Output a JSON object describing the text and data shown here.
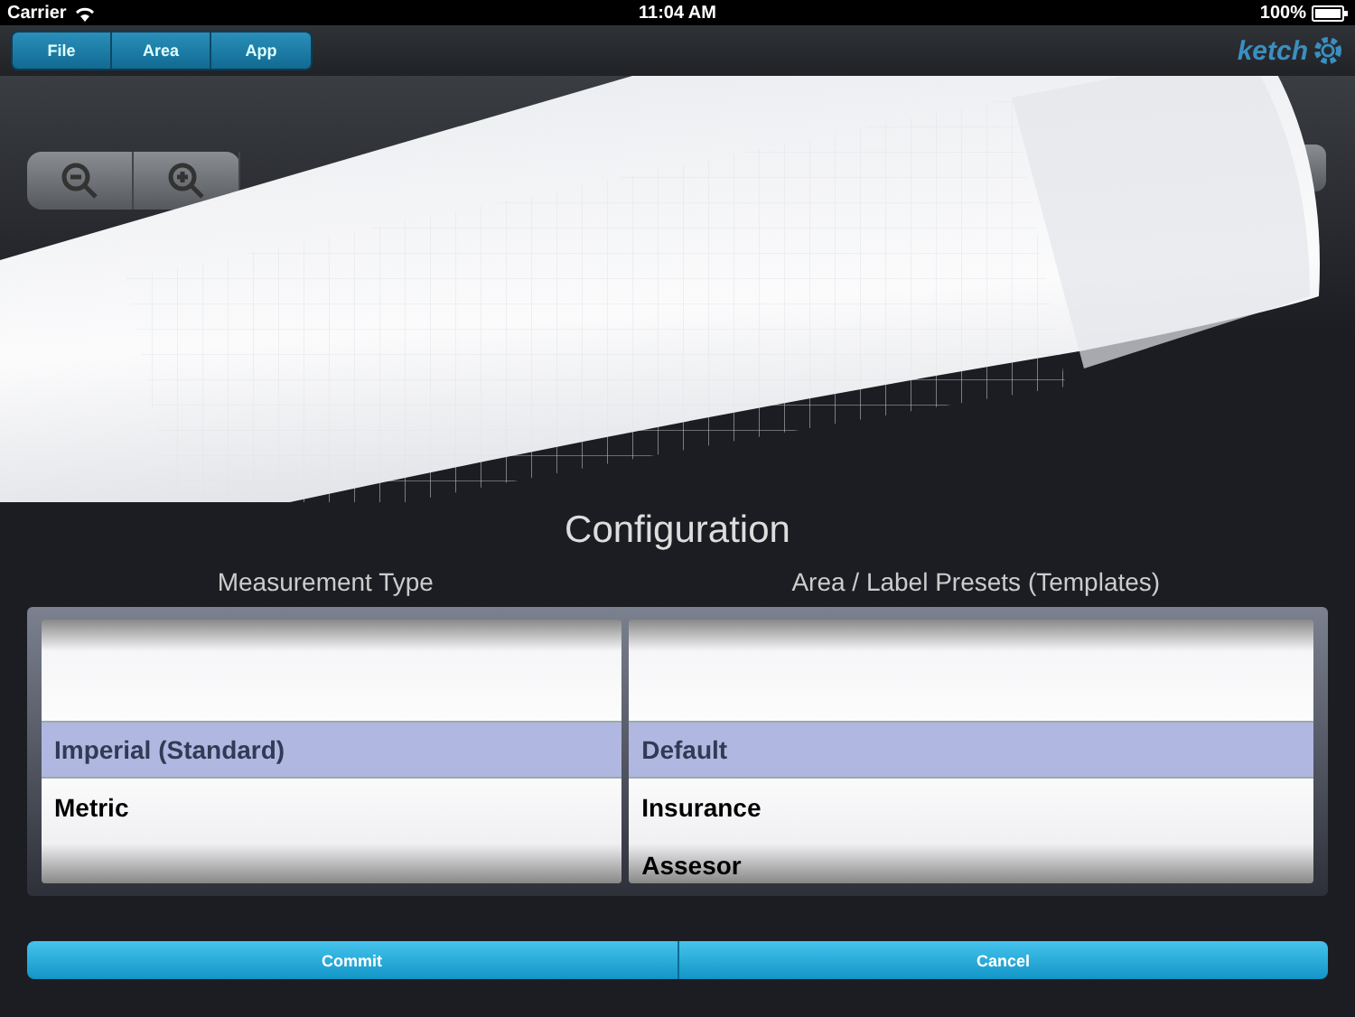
{
  "status_bar": {
    "carrier": "Carrier",
    "time": "11:04 AM",
    "battery": "100%"
  },
  "menu": [
    {
      "label": "File"
    },
    {
      "label": "Area"
    },
    {
      "label": "App"
    }
  ],
  "logo": "ketch",
  "title": "Configuration",
  "pickers": [
    {
      "heading": "Measurement Type",
      "items": [
        {
          "label": "Imperial (Standard)",
          "selected": true
        },
        {
          "label": "Metric",
          "selected": false
        }
      ]
    },
    {
      "heading": "Area / Label Presets (Templates)",
      "items": [
        {
          "label": "Default",
          "selected": true
        },
        {
          "label": "Insurance",
          "selected": false
        },
        {
          "label": "Assesor",
          "selected": false
        }
      ]
    }
  ],
  "buttons": [
    {
      "label": "Commit"
    },
    {
      "label": "Cancel"
    }
  ]
}
